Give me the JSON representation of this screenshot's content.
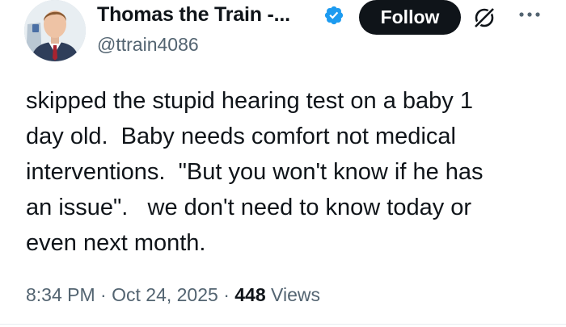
{
  "author": {
    "display_name": "Thomas the Train -...",
    "handle": "@ttrain4086",
    "verified": true,
    "avatar_icon": "person-avatar"
  },
  "header": {
    "follow_label": "Follow",
    "grok_icon": "grok-icon",
    "more_icon": "more-dots-icon"
  },
  "tweet": {
    "text": "skipped the stupid hearing test on a baby 1\nday old.  Baby needs comfort not medical\ninterventions.  \"But you won't know if he has\nan issue\".   we don't need to know today or\neven next month."
  },
  "meta": {
    "time": "8:34 PM",
    "separator": "·",
    "date": "Oct 24, 2025",
    "views_count": "448",
    "views_label": "Views"
  },
  "colors": {
    "text": "#0f1419",
    "secondary": "#536471",
    "verified_blue": "#1d9bf0",
    "button_bg": "#0f1419"
  }
}
